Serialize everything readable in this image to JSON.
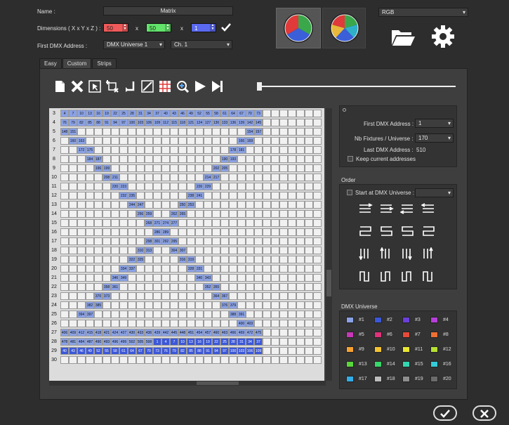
{
  "header": {
    "name_label": "Name :",
    "name_value": "Matrix",
    "dimensions_label": "Dimensions ( X x Y x Z ) :",
    "dim_x": "50",
    "dim_y": "50",
    "dim_z": "1",
    "times": "x",
    "first_dmx_label": "First DMX Address :",
    "universe_value": "DMX Universe 1",
    "channel_value": "Ch. 1",
    "color_mode": "RGB"
  },
  "tabs": [
    {
      "label": "Easy"
    },
    {
      "label": "Custom"
    },
    {
      "label": "Strips"
    }
  ],
  "grid": {
    "row_labels": [
      "3",
      "4",
      "5",
      "6",
      "7",
      "8",
      "9",
      "10",
      "11",
      "12",
      "13",
      "14",
      "15",
      "16",
      "17",
      "18",
      "19",
      "20",
      "21",
      "22",
      "23",
      "24",
      "25",
      "26",
      "27",
      "28",
      "29",
      "30"
    ],
    "top_row_3": [
      "4",
      "7",
      "10",
      "13",
      "16",
      "19",
      "22",
      "25",
      "28",
      "31",
      "34",
      "37",
      "40",
      "43",
      "46",
      "49",
      "52",
      "55",
      "58",
      "61",
      "64",
      "67",
      "70",
      "73"
    ],
    "top_row_4": [
      "76",
      "79",
      "82",
      "85",
      "88",
      "91",
      "94",
      "97",
      "100",
      "103",
      "106",
      "109",
      "112",
      "115",
      "118",
      "121",
      "124",
      "127",
      "130",
      "133",
      "136",
      "139",
      "142",
      "145"
    ],
    "diag_labels": [
      [
        "148",
        "151"
      ],
      [
        "160",
        "163"
      ],
      [
        "172",
        "175"
      ],
      [
        "184",
        "187"
      ],
      [
        "196",
        "199"
      ],
      [
        "208",
        "211"
      ],
      [
        "220",
        "223"
      ],
      [
        "232",
        "235"
      ],
      [
        "244",
        "247"
      ],
      [
        "256",
        "259"
      ],
      [
        "268",
        "271"
      ],
      [
        "280",
        "283"
      ],
      [
        "292",
        "295"
      ],
      [
        "304",
        "307"
      ],
      [
        "316",
        "319"
      ],
      [
        "328",
        "331"
      ],
      [
        "340",
        "343"
      ],
      [
        "352",
        "355"
      ],
      [
        "364",
        "367"
      ],
      [
        "376",
        "379"
      ],
      [
        "388",
        "391"
      ],
      [
        "400",
        "403"
      ],
      [
        "154",
        "157"
      ],
      [
        "166",
        "169"
      ],
      [
        "178",
        "181"
      ],
      [
        "190",
        "193"
      ],
      [
        "202",
        "205"
      ],
      [
        "214",
        "217"
      ],
      [
        "226",
        "229"
      ],
      [
        "238",
        "241"
      ],
      [
        "250",
        "253"
      ],
      [
        "262",
        "265"
      ],
      [
        "274",
        "277"
      ],
      [
        "286",
        "289"
      ],
      [
        "298",
        "301"
      ],
      [
        "310",
        "313"
      ],
      [
        "322",
        "325"
      ],
      [
        "334",
        "337"
      ],
      [
        "346",
        "349"
      ],
      [
        "358",
        "361"
      ],
      [
        "370",
        "373"
      ],
      [
        "382",
        "385"
      ],
      [
        "394",
        "397"
      ]
    ],
    "row_27": [
      "406",
      "409",
      "412",
      "415",
      "418",
      "421",
      "424",
      "427",
      "430",
      "433",
      "436",
      "439",
      "442",
      "445",
      "448",
      "451",
      "454",
      "457",
      "460",
      "463",
      "466",
      "469",
      "472",
      "475"
    ],
    "row_28": [
      "478",
      "481",
      "484",
      "487",
      "490",
      "493",
      "496",
      "499",
      "502",
      "505",
      "508",
      "1",
      "4",
      "7",
      "10",
      "13",
      "16",
      "19",
      "22",
      "25",
      "28",
      "31",
      "34",
      "37"
    ],
    "row_29": [
      "40",
      "43",
      "46",
      "49",
      "52",
      "55",
      "58",
      "61",
      "64",
      "67",
      "70",
      "73",
      "76",
      "79",
      "82",
      "85",
      "88",
      "91",
      "94",
      "97",
      "100",
      "103",
      "106",
      "109"
    ]
  },
  "right_panel": {
    "first_dmx_label": "First DMX Address :",
    "first_dmx_value": "1",
    "nb_fixtures_label": "Nb Fixtures / Universe :",
    "nb_fixtures_value": "170",
    "last_dmx_label": "Last DMX Address :",
    "last_dmx_value": "510",
    "keep_label": "Keep current addresses",
    "order_title": "Order",
    "start_dmx_label": "Start at DMX Universe :",
    "dmx_universe_title": "DMX Universe",
    "universes": [
      {
        "label": "#1",
        "color": "#8aa2e6"
      },
      {
        "label": "#2",
        "color": "#3b57d9"
      },
      {
        "label": "#3",
        "color": "#6b3fd9"
      },
      {
        "label": "#4",
        "color": "#b63fd9"
      },
      {
        "label": "#5",
        "color": "#c837b8"
      },
      {
        "label": "#6",
        "color": "#e0327a"
      },
      {
        "label": "#7",
        "color": "#e84a3a"
      },
      {
        "label": "#8",
        "color": "#ee6f33"
      },
      {
        "label": "#9",
        "color": "#f5a233"
      },
      {
        "label": "#10",
        "color": "#f5c332"
      },
      {
        "label": "#11",
        "color": "#e8e633"
      },
      {
        "label": "#12",
        "color": "#b6e033"
      },
      {
        "label": "#13",
        "color": "#59d83a"
      },
      {
        "label": "#14",
        "color": "#37d76a"
      },
      {
        "label": "#15",
        "color": "#33d6b0"
      },
      {
        "label": "#16",
        "color": "#33ccd8"
      },
      {
        "label": "#17",
        "color": "#33aee8"
      },
      {
        "label": "#18",
        "color": "#bdbdbd"
      },
      {
        "label": "#19",
        "color": "#8e8e8e"
      },
      {
        "label": "#20",
        "color": "#6b6b6b"
      }
    ]
  },
  "colors": {
    "accent_blue": "#8aa2e6",
    "accent_blue_dark": "#3b57d9",
    "dim_x_bg": "#f05a5a",
    "dim_y_bg": "#62e26a",
    "dim_z_bg": "#5a6af0"
  }
}
